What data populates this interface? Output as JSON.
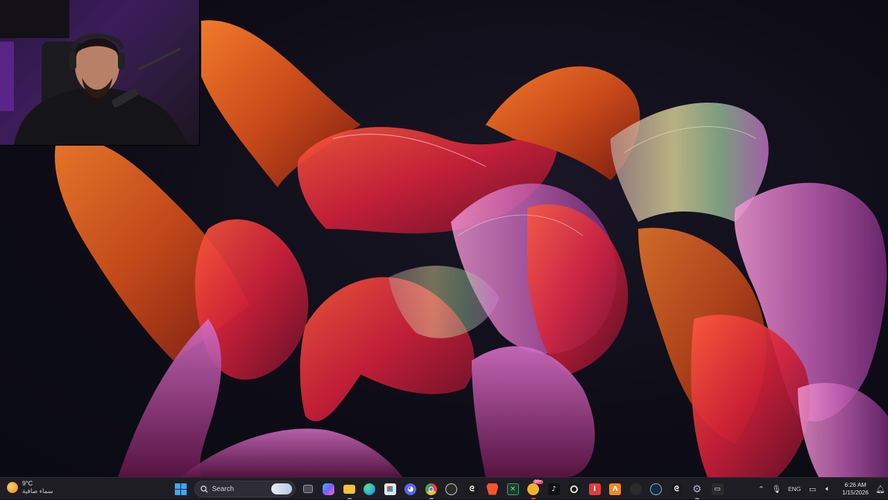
{
  "weather": {
    "temperature": "9°C",
    "condition": "سماء صافية",
    "icon": "weather-sun-moon-icon"
  },
  "search": {
    "placeholder": "Search"
  },
  "taskbar_apps": [
    {
      "name": "start-button",
      "icon": "windows-logo-icon",
      "color": "#3ea6ff"
    },
    {
      "name": "task-view-button",
      "icon": "task-view-icon",
      "color": "#9b9ba6"
    },
    {
      "name": "copilot-button",
      "icon": "copilot-icon",
      "color": "#7c5cff"
    },
    {
      "name": "file-explorer-button",
      "icon": "folder-icon",
      "color": "#f4c23c"
    },
    {
      "name": "edge-button",
      "icon": "edge-icon",
      "color": "#2bb2d9"
    },
    {
      "name": "store-button",
      "icon": "store-icon",
      "color": "#d9d9df"
    },
    {
      "name": "discord-button",
      "icon": "discord-icon",
      "color": "#5865f2"
    },
    {
      "name": "chrome-button",
      "icon": "chrome-icon",
      "color": "#e8453c"
    },
    {
      "name": "obs-button",
      "icon": "obs-icon",
      "color": "#2b2b2b"
    },
    {
      "name": "capcut-button",
      "icon": "capcut-icon",
      "color": "#1b1b1b"
    },
    {
      "name": "brave-button",
      "icon": "brave-icon",
      "color": "#fb542b"
    },
    {
      "name": "excel-like-button",
      "icon": "spreadsheet-icon",
      "color": "#107c41"
    },
    {
      "name": "messenger-button",
      "icon": "chat-icon",
      "color": "#f2b230",
      "badge": "99+"
    },
    {
      "name": "tiktok-button",
      "icon": "tiktok-icon",
      "color": "#111111"
    },
    {
      "name": "app-ring-button",
      "icon": "ring-icon",
      "color": "#1a1a1a"
    },
    {
      "name": "flstudio-button",
      "icon": "app-red-icon",
      "color": "#e33b3b"
    },
    {
      "name": "app-orange-button",
      "icon": "app-orange-icon",
      "color": "#f08a24"
    },
    {
      "name": "steam-alt-button",
      "icon": "app-dark-icon",
      "color": "#2b2b2b"
    },
    {
      "name": "steam-button",
      "icon": "steam-icon",
      "color": "#1b2838"
    },
    {
      "name": "capcut2-button",
      "icon": "capcut-icon",
      "color": "#1b1b1b"
    },
    {
      "name": "settings-button",
      "icon": "gear-icon",
      "color": "#8a8aa0"
    },
    {
      "name": "game-button",
      "icon": "gamepad-icon",
      "color": "#2b2b2b"
    }
  ],
  "tray": {
    "language": "ENG",
    "time": "6:26 AM",
    "date": "1/15/2026"
  }
}
